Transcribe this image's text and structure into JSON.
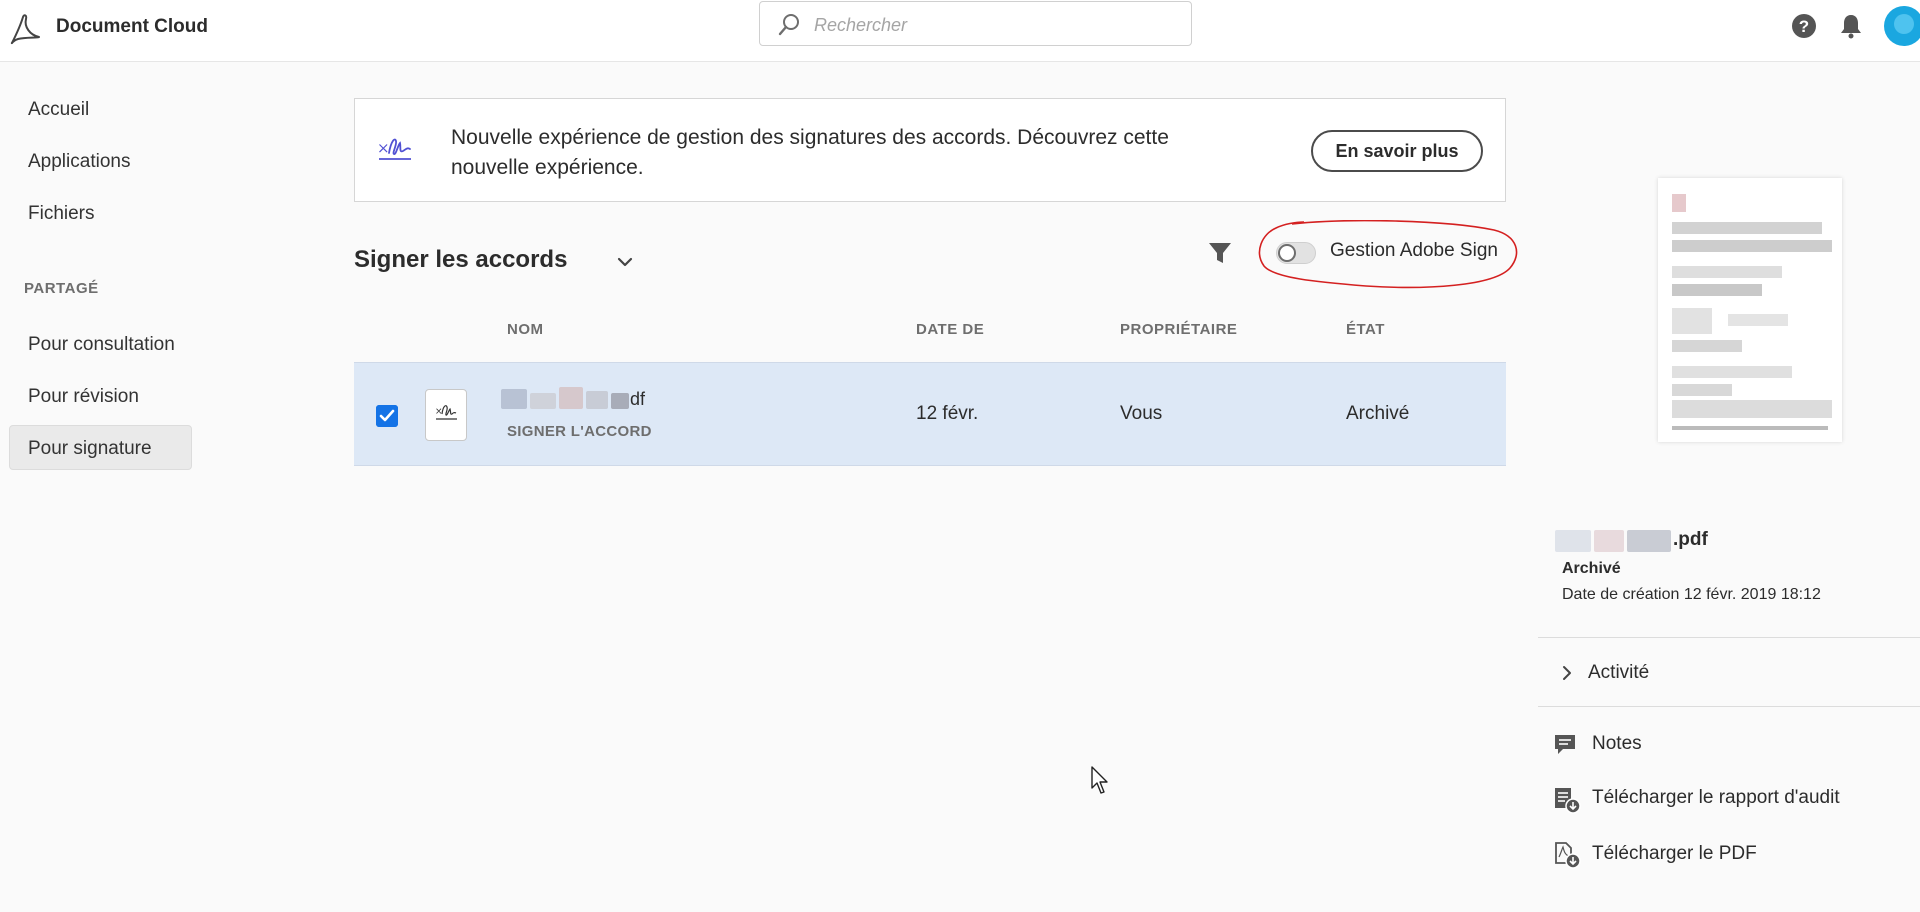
{
  "header": {
    "brand": "Document Cloud",
    "search_placeholder": "Rechercher"
  },
  "sidebar": {
    "items": [
      {
        "label": "Accueil"
      },
      {
        "label": "Applications"
      },
      {
        "label": "Fichiers"
      }
    ],
    "section_title": "PARTAGÉ",
    "shared_items": [
      {
        "label": "Pour consultation"
      },
      {
        "label": "Pour révision"
      },
      {
        "label": "Pour signature",
        "active": true
      }
    ]
  },
  "banner": {
    "text": "Nouvelle expérience de gestion des signatures des accords. Découvrez cette nouvelle expérience.",
    "button": "En savoir plus"
  },
  "list": {
    "title": "Signer les accords",
    "toggle_label": "Gestion Adobe Sign",
    "toggle_on": false,
    "columns": [
      "NOM",
      "DATE DE",
      "PROPRIÉTAIRE",
      "ÉTAT"
    ],
    "rows": [
      {
        "name_suffix": "df",
        "type": "SIGNER L'ACCORD",
        "date": "12 févr.",
        "owner": "Vous",
        "status": "Archivé",
        "checked": true
      }
    ]
  },
  "details": {
    "name_suffix": ".pdf",
    "status": "Archivé",
    "created": "Date de création 12 févr. 2019 18:12",
    "activity": "Activité",
    "actions": [
      {
        "label": "Notes",
        "icon": "comment-icon"
      },
      {
        "label": "Télécharger le rapport d'audit",
        "icon": "audit-report-download-icon"
      },
      {
        "label": "Télécharger le PDF",
        "icon": "pdf-download-icon"
      }
    ]
  },
  "colors": {
    "accent": "#1473e6",
    "row_selected": "#dde8f6",
    "annotation": "#d42020",
    "avatar": "#1aa7e0"
  }
}
